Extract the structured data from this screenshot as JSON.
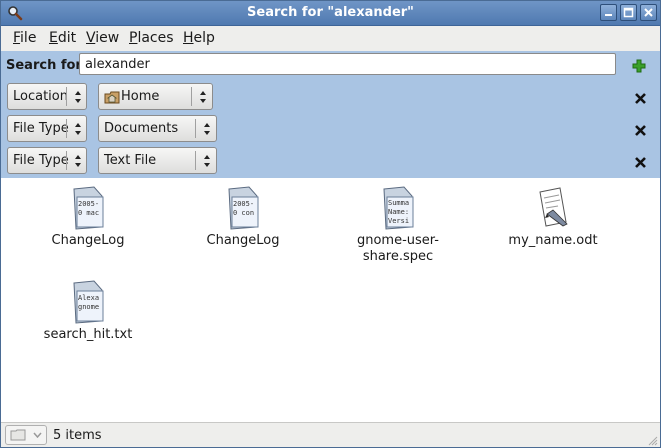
{
  "window": {
    "title": "Search for \"alexander\""
  },
  "menu": [
    {
      "first": "F",
      "rest": "ile"
    },
    {
      "first": "E",
      "rest": "dit"
    },
    {
      "first": "V",
      "rest": "iew"
    },
    {
      "first": "P",
      "rest": "laces"
    },
    {
      "first": "H",
      "rest": "elp"
    }
  ],
  "search": {
    "label": "Search for:",
    "value": "alexander"
  },
  "filters": [
    {
      "type": "Location",
      "value": "Home"
    },
    {
      "type": "File Type",
      "value": "Documents"
    },
    {
      "type": "File Type",
      "value": "Text File"
    }
  ],
  "results": [
    {
      "name": "ChangeLog",
      "preview": [
        "2005-",
        "0 mac"
      ],
      "icon": "text-doc-icon"
    },
    {
      "name": "ChangeLog",
      "preview": [
        "2005-",
        "0 con"
      ],
      "icon": "text-doc-icon"
    },
    {
      "name": "gnome-user-\nshare.spec",
      "preview": [
        "Summa",
        "Name:",
        "Versi"
      ],
      "icon": "text-doc-icon"
    },
    {
      "name": "my_name.odt",
      "preview": [],
      "icon": "document-pen-icon"
    },
    {
      "name": "search_hit.txt",
      "preview": [
        "Alexa",
        "gnome"
      ],
      "icon": "text-doc-icon"
    }
  ],
  "status": {
    "text": "5 items"
  },
  "colors": {
    "titlebar": "#5a82b8",
    "criteria": "#a9c4e3",
    "add": "#3aa02a"
  }
}
